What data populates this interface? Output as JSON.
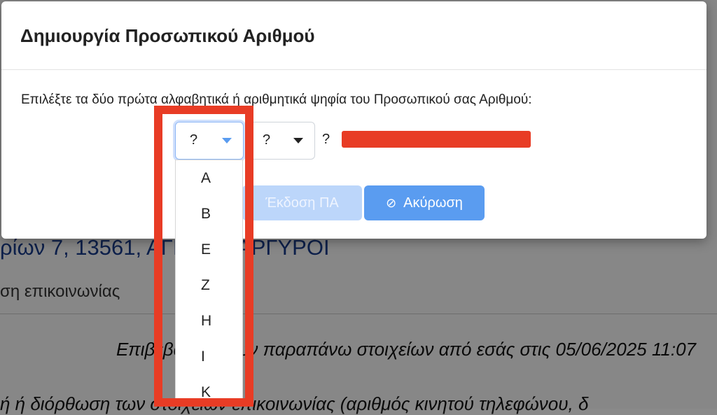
{
  "background": {
    "address": "ρίων 7, 13561, ΑΓΙΟΙ ΑΝΑΡΓΥΡΟΙ",
    "contact_label": "ση επικοινωνίας",
    "confirmation": "Επιβεβαίωση των παραπάνω στοιχείων από εσάς στις 05/06/2025 11:07",
    "edit_text": "ή ή διόρθωση των στοιχείων επικοινωνίας (αριθμός κινητού τηλεφώνου, δ"
  },
  "modal": {
    "title": "Δημιουργία Προσωπικού Αριθμού",
    "instruction": "Επιλέξτε τα δύο πρώτα αλφαβητικά ή αριθμητικά ψηφία του Προσωπικού σας Αριθμού:",
    "select1_value": "?",
    "select2_value": "?",
    "extra_placeholder": "?",
    "issue_button": "Έκδοση ΠΑ",
    "cancel_button": "Ακύρωση"
  },
  "dropdown": {
    "options": [
      "A",
      "B",
      "E",
      "Z",
      "H",
      "I",
      "K"
    ]
  },
  "colors": {
    "accent": "#5a9cf0",
    "annotation": "#e83c25"
  },
  "icons": {
    "cancel": "ban-icon",
    "caret": "caret-down-icon"
  }
}
